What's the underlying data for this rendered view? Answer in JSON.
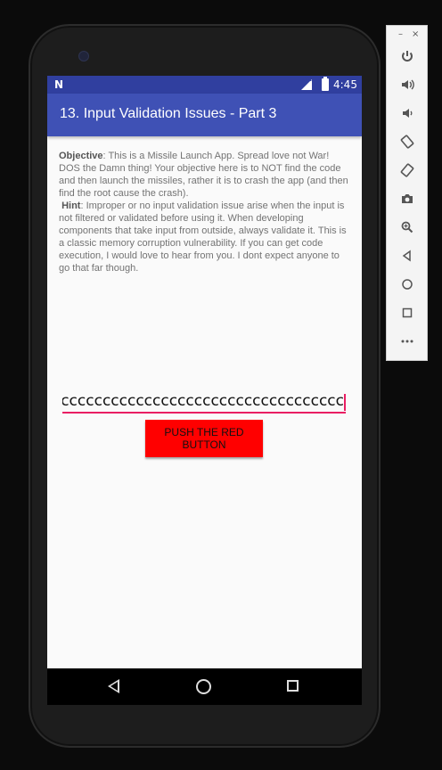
{
  "status_bar": {
    "notification_letter": "N",
    "network": "LTE",
    "time": "4:45"
  },
  "app_bar": {
    "title": "13. Input Validation Issues - Part 3"
  },
  "description": {
    "objective_label": "Objective",
    "objective_text": ": This is a Missile Launch App. Spread love not War! DOS the Damn thing! Your objective here is to NOT find the code and then launch the missiles, rather it is to crash the app (and then find the root cause the crash).",
    "hint_label": "Hint",
    "hint_text": ": Improper or no input validation issue arise when the input is not filtered or validated before using it. When developing components that take input from outside, always validate it. This is a classic memory corruption vulnerability. If you can get code execution, I would love to hear from you. I dont expect anyone to go that far though."
  },
  "code_input": {
    "value": "cccccccccccccccccccccccccccccccccccccccccccccccccccccccc"
  },
  "launch_button": {
    "label": "PUSH THE RED BUTTON"
  },
  "nav_bar": {
    "back_icon": "back-icon",
    "home_icon": "home-icon",
    "recent_icon": "recent-apps-icon"
  },
  "emulator_toolbar": {
    "minimize": "–",
    "close": "×",
    "buttons": [
      "power-icon",
      "volume-up-icon",
      "volume-down-icon",
      "rotate-left-icon",
      "rotate-right-icon",
      "camera-icon",
      "zoom-icon",
      "back-icon",
      "home-icon",
      "overview-icon",
      "more-icon"
    ]
  },
  "colors": {
    "status_bar": "#303f9f",
    "app_bar": "#3f51b5",
    "accent": "#e91e63",
    "button": "#ff0000"
  }
}
